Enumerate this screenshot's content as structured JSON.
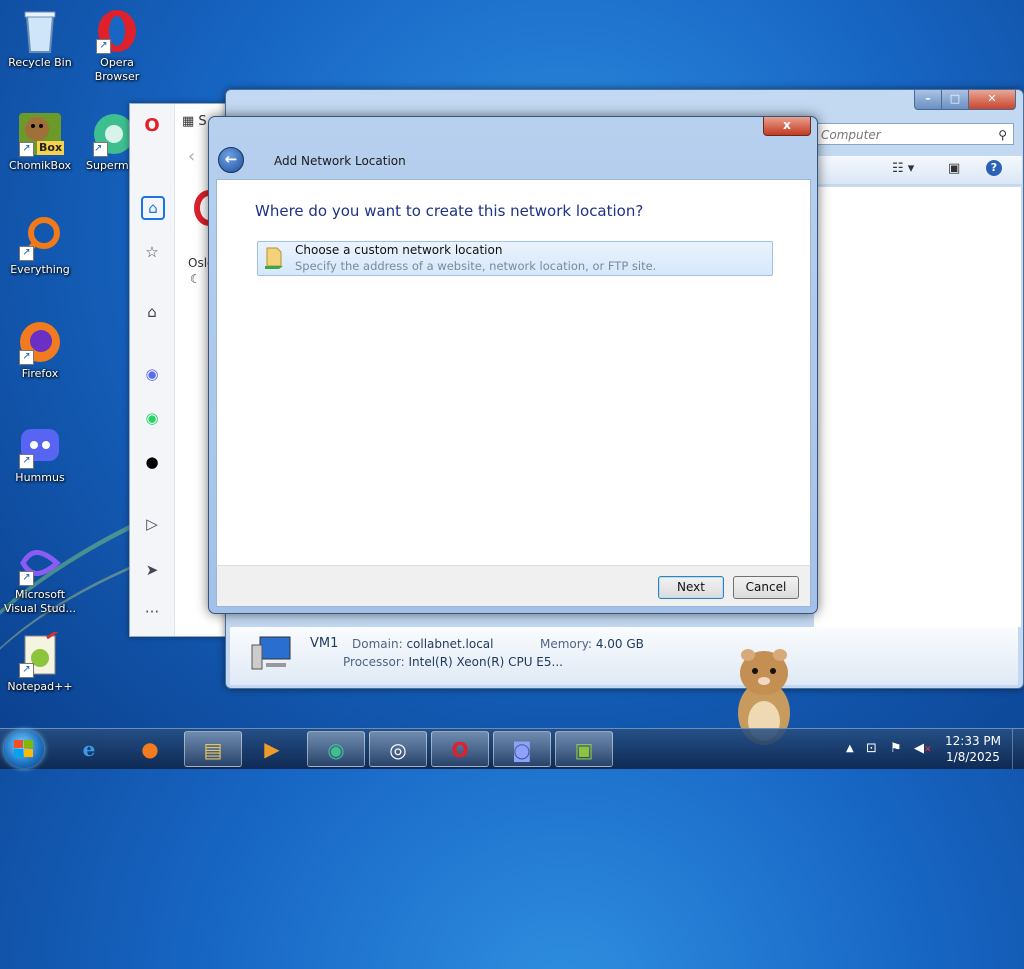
{
  "desktop": {
    "icons": [
      {
        "label": "Recycle Bin",
        "icon": "recycle-bin-icon"
      },
      {
        "label": "Opera\nBrowser",
        "icon": "opera-icon"
      },
      {
        "label": "ChomikBox",
        "icon": "chomikbox-icon"
      },
      {
        "label": "Superm",
        "icon": "supermium-icon"
      },
      {
        "label": "Everything",
        "icon": "everything-icon"
      },
      {
        "label": "Firefox",
        "icon": "firefox-icon"
      },
      {
        "label": "Hummus",
        "icon": "discord-icon"
      },
      {
        "label": "Microsoft\nVisual Stud...",
        "icon": "visual-studio-icon"
      },
      {
        "label": "Notepad++",
        "icon": "notepadpp-icon"
      }
    ],
    "chomikbox_badge": "Box"
  },
  "opera_window": {
    "search_fragment": "S",
    "city_fragment": "Oslo"
  },
  "explorer": {
    "search_placeholder": "Computer",
    "details": {
      "name": "VM1",
      "domain_label": "Domain:",
      "domain_value": "collabnet.local",
      "memory_label": "Memory:",
      "memory_value": "4.00 GB",
      "processor_label": "Processor:",
      "processor_value": "Intel(R) Xeon(R) CPU E5..."
    }
  },
  "dialog": {
    "title": "Add Network Location",
    "heading": "Where do you want to create this network location?",
    "option": {
      "title": "Choose a custom network location",
      "description": "Specify the address of a website, network location, or FTP site."
    },
    "next_label": "Next",
    "cancel_label": "Cancel",
    "close_glyph": "x"
  },
  "taskbar": {
    "items": [
      "internet-explorer",
      "firefox",
      "file-explorer",
      "media-player",
      "supermium",
      "obama-app",
      "opera",
      "discord",
      "notepadpp"
    ],
    "clock_time": "12:33 PM",
    "clock_date": "1/8/2025"
  },
  "colors": {
    "heading_blue": "#1e3287",
    "desktop_blue": "#1766c4"
  }
}
